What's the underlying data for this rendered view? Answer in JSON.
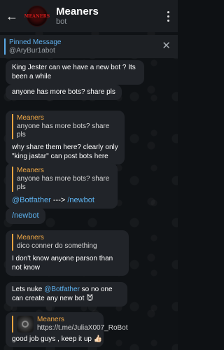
{
  "header": {
    "back_icon": "arrow-left-icon",
    "avatar_text": "MEANERS",
    "title": "Meaners",
    "subtitle": "bot",
    "menu_icon": "more-vertical-icon"
  },
  "pinned": {
    "title": "Pinned Message",
    "text": "@AryBur1abot",
    "close_icon": "close-icon"
  },
  "messages": [
    {
      "text": "King Jester can we have a new bot ? Its been a while"
    },
    {
      "text": "anyone has more bots? share pls"
    },
    {
      "reply_name": "Meaners",
      "reply_text": "anyone has more bots? share pls",
      "text": "why share them here? clearly only \"king jastar\" can post bots here"
    },
    {
      "reply_name": "Meaners",
      "reply_text": "anyone has more bots? share pls",
      "link1": "@Botfather",
      "arrow": " ---> ",
      "link2": "/newbot"
    },
    {
      "link": "/newbot"
    },
    {
      "reply_name": "Meaners",
      "reply_text": "dico conner do something",
      "text": "I don't know anyone parson than not know"
    },
    {
      "text_before": "Lets nuke ",
      "link": "@Botfather",
      "text_after": " so no one can create any new bot ",
      "emoji": "😈"
    },
    {
      "reply_name": "Meaners",
      "reply_text": "https://t.me/JuliaX007_RoBot",
      "text": "good job guys , keep it up ",
      "emoji": "👍🏻"
    }
  ],
  "colors": {
    "accent_link": "#5eb4f2",
    "reply_accent": "#e9a33f",
    "bubble": "#212429",
    "header": "#1a1d21"
  }
}
